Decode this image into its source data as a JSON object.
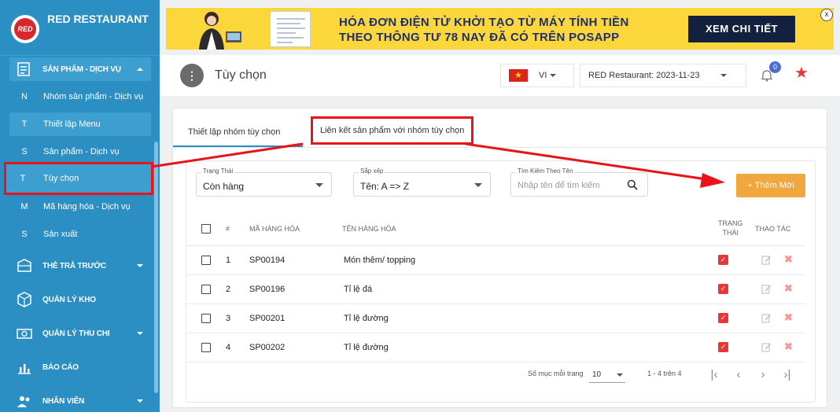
{
  "app": {
    "brand": "RED RESTAURANT",
    "logo_text": "RED"
  },
  "sidebar": {
    "group_products": "SẢN PHẨM - DỊCH VỤ",
    "sub_items": [
      {
        "letter": "N",
        "label": "Nhóm sản phẩm - Dịch vụ"
      },
      {
        "letter": "T",
        "label": "Thiết lập Menu"
      },
      {
        "letter": "S",
        "label": "Sản phẩm - Dịch vụ"
      },
      {
        "letter": "T",
        "label": "Tùy chọn"
      },
      {
        "letter": "M",
        "label": "Mã hàng hóa - Dịch vụ"
      },
      {
        "letter": "S",
        "label": "Sản xuất"
      }
    ],
    "groups": [
      {
        "label": "THẺ TRẢ TRƯỚC",
        "icon": "prepaid-card-icon"
      },
      {
        "label": "QUẢN LÝ KHO",
        "icon": "warehouse-box-icon"
      },
      {
        "label": "QUẢN LÝ THU CHI",
        "icon": "cash-icon"
      },
      {
        "label": "BÁO CÁO",
        "icon": "bar-chart-icon"
      },
      {
        "label": "NHÂN VIÊN",
        "icon": "staff-icon"
      }
    ]
  },
  "banner": {
    "line1": "HÓA ĐƠN ĐIỆN TỬ KHỞI TẠO TỪ MÁY TÍNH TIỀN",
    "line2": "THEO THÔNG TƯ 78 NAY ĐÃ CÓ TRÊN POSAPP",
    "button": "XEM CHI TIẾT",
    "close": "x"
  },
  "header": {
    "title": "Tùy chọn",
    "menu_glyph": "⋮",
    "language": "VI",
    "store": "RED Restaurant: 2023-11-23",
    "notifications": "0"
  },
  "tabs": [
    {
      "label": "Thiết lập nhóm tùy chọn"
    },
    {
      "label": "Liên kết sản phẩm với nhóm tùy chọn"
    }
  ],
  "filters": {
    "status_label": "Trạng Thái",
    "status_value": "Còn hàng",
    "sort_label": "Sắp xếp",
    "sort_value": "Tên: A => Z",
    "search_label": "Tìm Kiếm Theo Tên",
    "search_placeholder": "Nhập tên để tìm kiếm",
    "add_button": "+ Thêm Mới"
  },
  "table": {
    "headers": {
      "index": "#",
      "code": "MÃ HÀNG HÓA",
      "name": "TÊN HÀNG HÓA",
      "status_l1": "TRẠNG",
      "status_l2": "THÁI",
      "actions": "THAO TÁC"
    },
    "rows": [
      {
        "index": "1",
        "code": "SP00194",
        "name": "Món thêm/ topping",
        "active": true
      },
      {
        "index": "2",
        "code": "SP00196",
        "name": "Tỉ lệ đá",
        "active": true
      },
      {
        "index": "3",
        "code": "SP00201",
        "name": "Tỉ lệ đường",
        "active": true
      },
      {
        "index": "4",
        "code": "SP00202",
        "name": "Tỉ lệ đường",
        "active": true
      }
    ]
  },
  "pagination": {
    "per_page_label": "Số mục mỗi trang",
    "per_page_value": "10",
    "range": "1 - 4 trên 4"
  },
  "colors": {
    "sidebar": "#2b8fc4",
    "annotation_red": "#e8141a",
    "add_button": "#f0a73d",
    "checkbox_red": "#e53935"
  }
}
